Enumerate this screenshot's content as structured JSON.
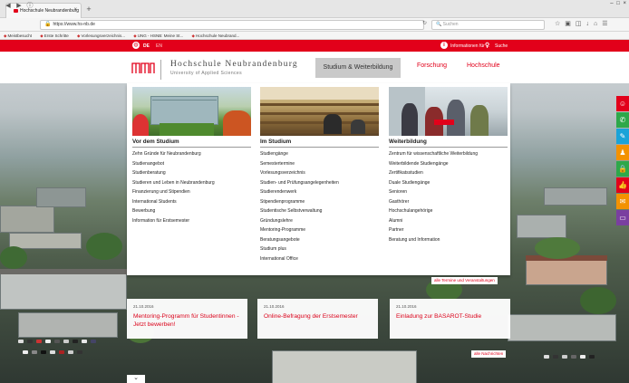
{
  "browser": {
    "tab_title": "Hochschule Neubrandenburg",
    "tab_close": "×",
    "new_tab": "+",
    "window_controls": "– □ ×",
    "url": "https://www.hs-nb.de",
    "search_placeholder": "Suchen",
    "bookmarks": [
      "Meistbesucht",
      "Erste Schritte",
      "Vorlesungsverzeichnis...",
      "UNG - HSNB: Meine St...",
      "Hochschule Neubrand..."
    ]
  },
  "topbar": {
    "lang_de": "DE",
    "lang_en": "EN",
    "info": "Informationen für ...",
    "search": "Suche"
  },
  "header": {
    "name": "Hochschule Neubrandenburg",
    "subtitle": "University of Applied Sciences",
    "nav": [
      "Studium & Weiterbildung",
      "Forschung",
      "Hochschule"
    ]
  },
  "mega_menu": {
    "columns": [
      {
        "heading": "Vor dem Studium",
        "items": [
          "Zehn Gründe für Neubrandenburg",
          "Studienangebot",
          "Studienberatung",
          "Studieren und Leben in Neubrandenburg",
          "Finanzierung und Stipendien",
          "International Students",
          "Bewerbung",
          "Information für Erstsemester"
        ]
      },
      {
        "heading": "Im Studium",
        "items": [
          "Studiengänge",
          "Semestertermine",
          "Vorlesungsverzeichnis",
          "Studien- und Prüfungsangelegenheiten",
          "Studierendenwerk",
          "Stipendienprogramme",
          "Studentische Selbstverwaltung",
          "Gründungslehre",
          "Mentoring-Programme",
          "Beratungsangebote",
          "Studium plus",
          "International Office"
        ]
      },
      {
        "heading": "Weiterbildung",
        "items": [
          "Zentrum für wissenschaftliche Weiterbildung",
          "Weiterbildende Studiengänge",
          "Zertifikatsstudien",
          "Duale Studiengänge",
          "Senioren",
          "Gasthörer",
          "Hochschulangehörige",
          "Alumni",
          "Partner",
          "Beratung und Information"
        ]
      }
    ]
  },
  "news": {
    "events_link": "alle Termine und Veranstaltungen",
    "all_news_link": "alle Nachrichten",
    "cards": [
      {
        "date": "21.10.2016",
        "title": "Mentoring-Programm für Studentinnen - Jetzt bewerben!"
      },
      {
        "date": "21.10.2016",
        "title": "Online-Befragung der Erstsemester"
      },
      {
        "date": "21.10.2016",
        "title": "Einladung zur BASAROT-Studie"
      }
    ]
  },
  "side_icons": {
    "glyphs": [
      "☺",
      "✆",
      "✎",
      "♟",
      "🔒",
      "👍",
      "✉",
      "▭"
    ],
    "colors": [
      "#e2001a",
      "#2ea84a",
      "#1aa3d8",
      "#f39200",
      "#2ea84a",
      "#e2001a",
      "#f39200",
      "#7a3fa0"
    ]
  },
  "accent_color": "#e2001a"
}
